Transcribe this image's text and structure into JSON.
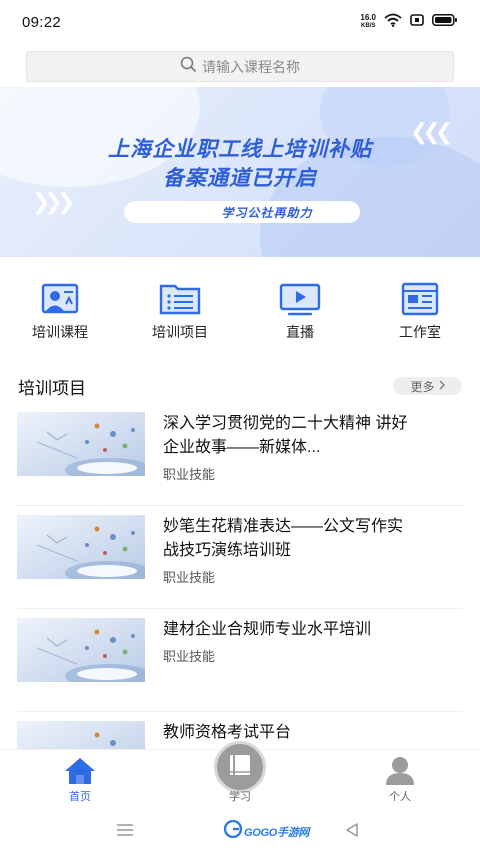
{
  "status_bar": {
    "time": "09:22",
    "net_speed_value": "16.0",
    "net_speed_unit": "KB/S",
    "icons": [
      "wifi-icon",
      "notification-icon",
      "battery-icon"
    ]
  },
  "search": {
    "placeholder": "请输入课程名称",
    "icon": "search-icon"
  },
  "banner": {
    "line1": "上海企业职工线上培训补贴",
    "line2": "备案通道已开启",
    "pill_text": "学习公社再助力",
    "accent_color": "#2f5fd7"
  },
  "quick_nav": [
    {
      "label": "培训课程",
      "icon": "course-icon"
    },
    {
      "label": "培训项目",
      "icon": "project-icon"
    },
    {
      "label": "直播",
      "icon": "live-icon"
    },
    {
      "label": "工作室",
      "icon": "studio-icon"
    }
  ],
  "section": {
    "title": "培训项目",
    "more_label": "更多"
  },
  "courses": [
    {
      "title": "深入学习贯彻党的二十大精神 讲好企业故事——新媒体...",
      "tag": "职业技能"
    },
    {
      "title": "妙笔生花精准表达——公文写作实战技巧演练培训班",
      "tag": "职业技能"
    },
    {
      "title": "建材企业合规师专业水平培训",
      "tag": "职业技能"
    },
    {
      "title": "教师资格考试平台",
      "tag": ""
    }
  ],
  "bottom_nav": {
    "home_label": "首页",
    "study_label": "学习",
    "profile_label": "个人",
    "active_color": "#2f6be6"
  },
  "watermark": {
    "text": "GOGO手游网"
  }
}
